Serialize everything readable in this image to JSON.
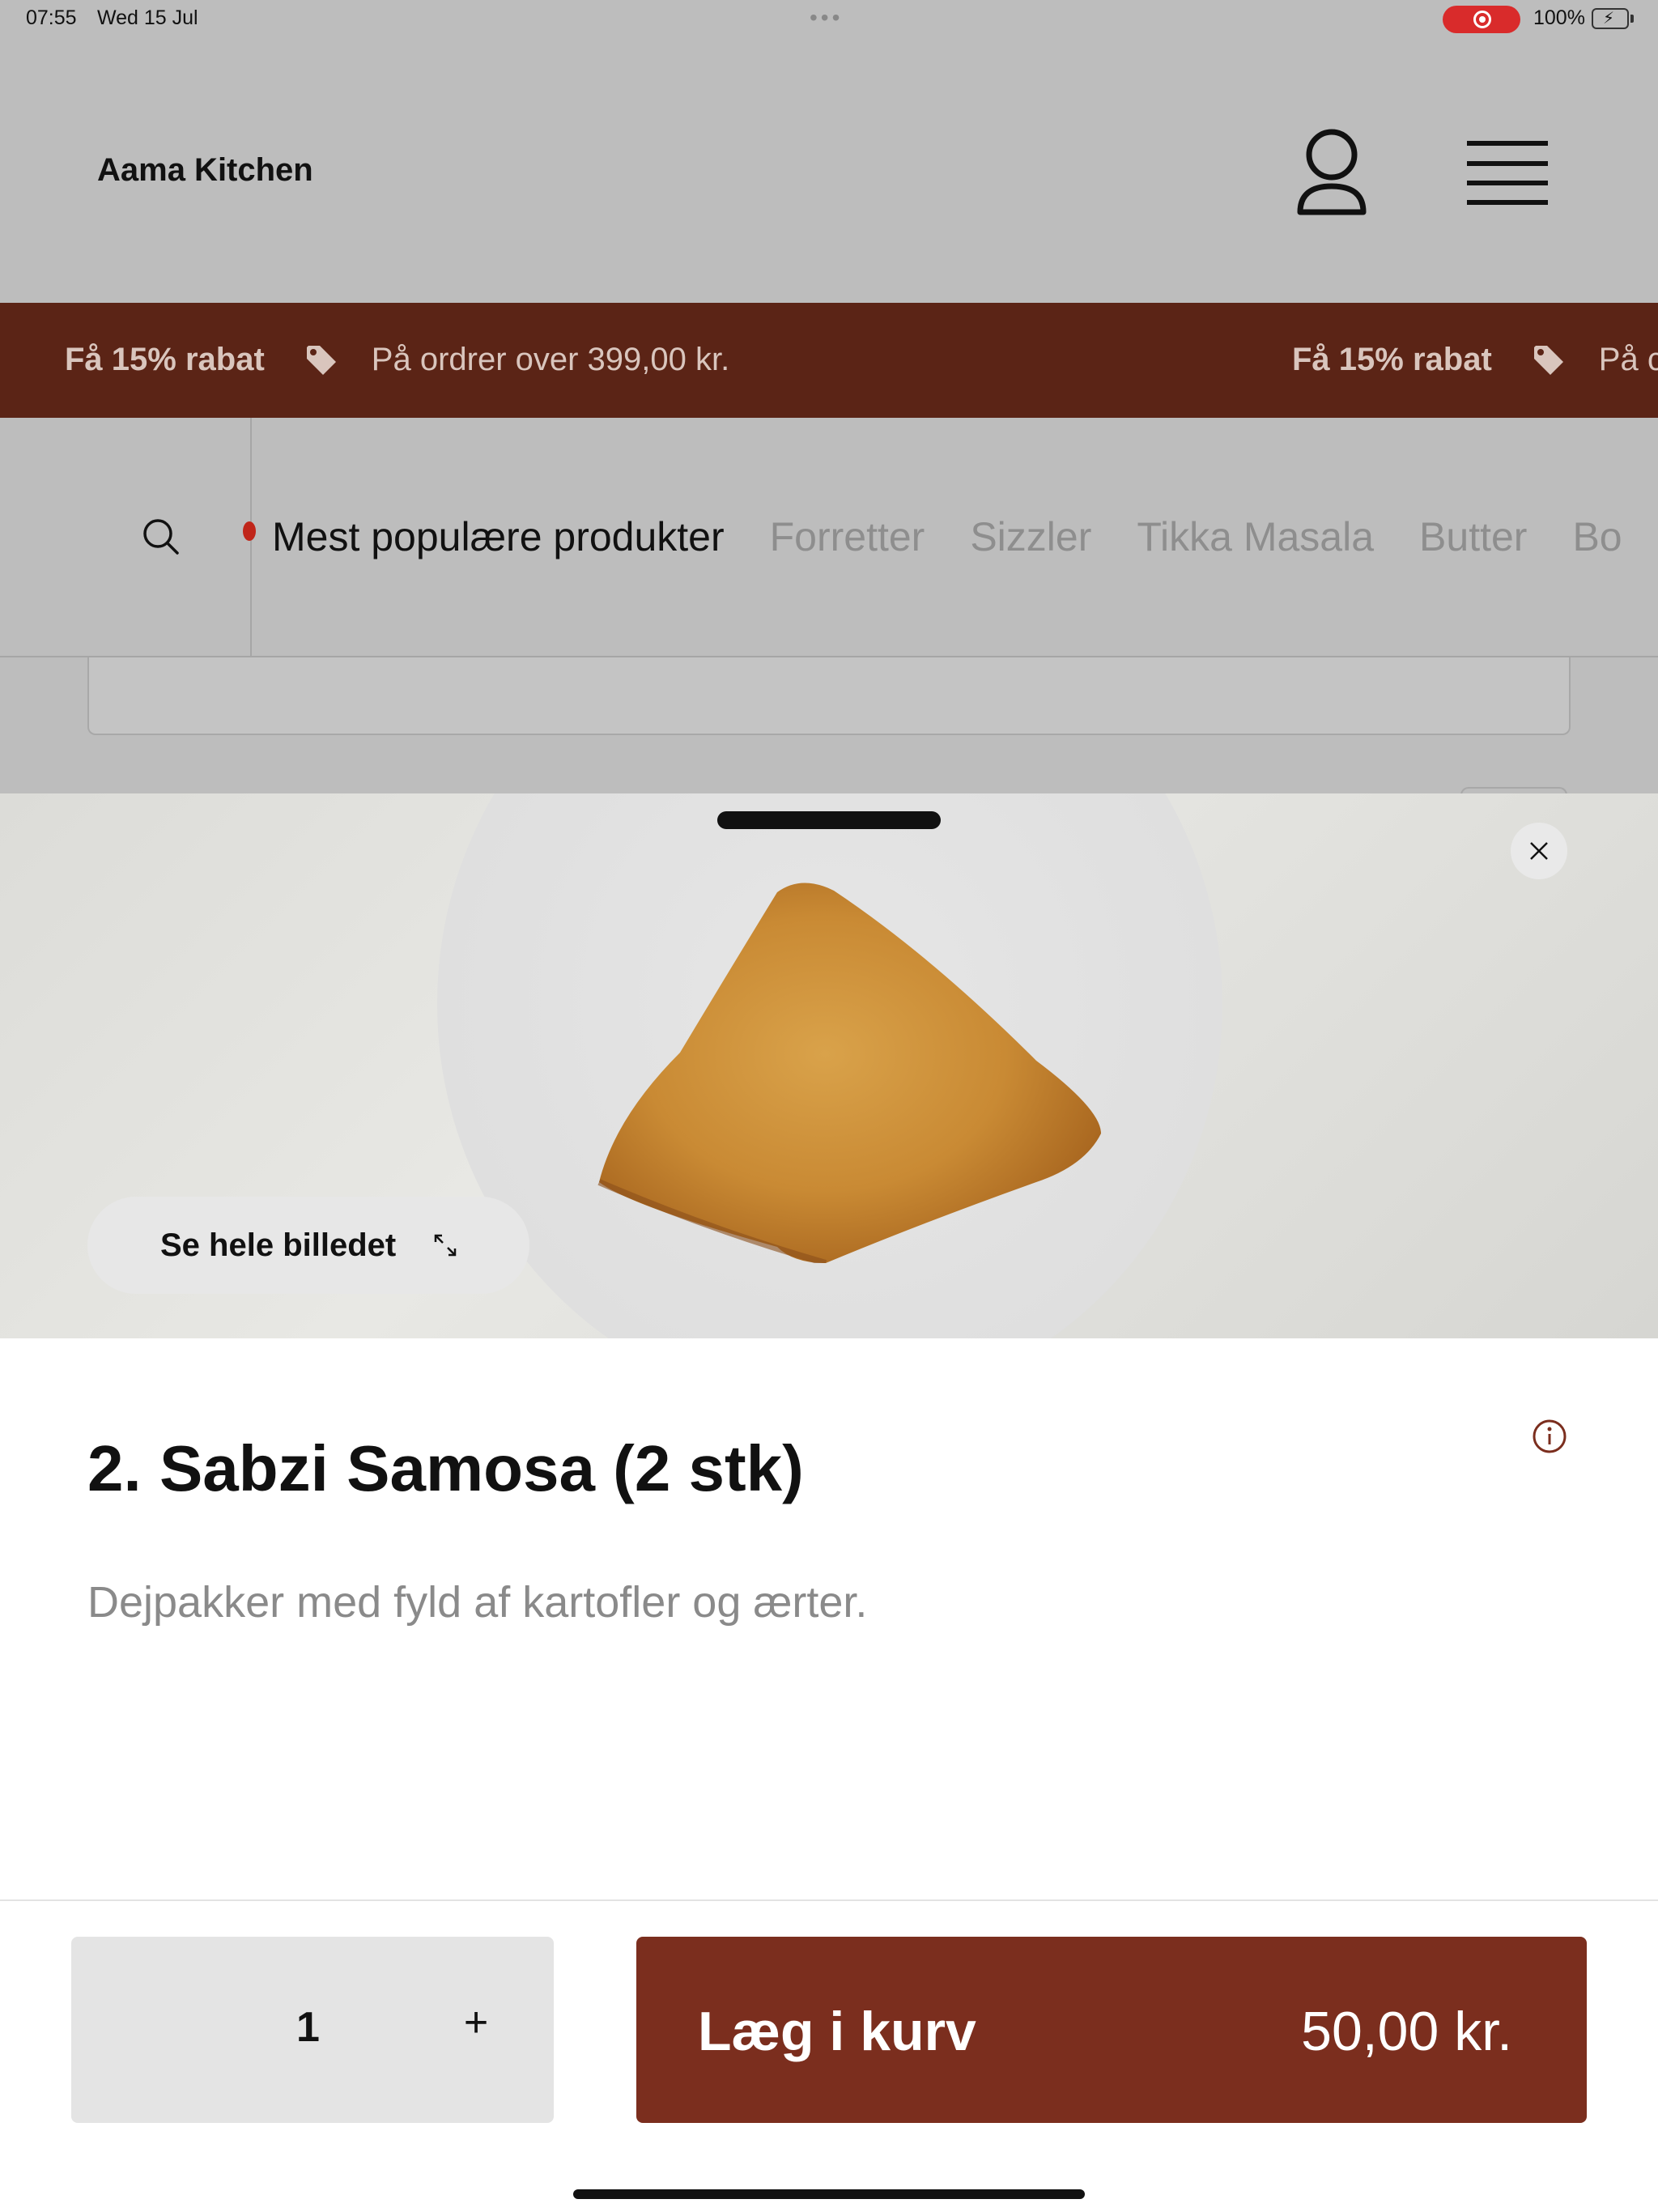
{
  "status_bar": {
    "time": "07:55",
    "date": "Wed 15 Jul",
    "battery_percent": "100%",
    "battery_level": 1.0,
    "recording": true
  },
  "header": {
    "brand": "Aama Kitchen",
    "account_icon": "person-icon",
    "menu_icon": "hamburger-menu-icon"
  },
  "promo": {
    "items": [
      {
        "title": "Få 15% rabat",
        "icon": "tag-icon",
        "subtitle": "På ordrer over 399,00 kr."
      },
      {
        "title": "Få 15% rabat",
        "icon": "tag-icon",
        "subtitle": "På c"
      }
    ]
  },
  "categories": {
    "search_icon": "search-icon",
    "active": "Mest populære produkter",
    "items": [
      "Forretter",
      "Sizzler",
      "Tikka Masala",
      "Butter",
      "Bo"
    ]
  },
  "product_sheet": {
    "see_full_image": "Se hele billedet",
    "title": "2. Sabzi Samosa (2 stk)",
    "description": "Dejpakker med fyld af kartofler og ærter.",
    "quantity": "1",
    "increment": "+",
    "add_to_cart": "Læg i kurv",
    "price": "50,00 kr."
  },
  "colors": {
    "promo_bg": "#5b2416",
    "primary_button": "#7b2e1e",
    "overlay_gray": "#bdbdbd"
  }
}
